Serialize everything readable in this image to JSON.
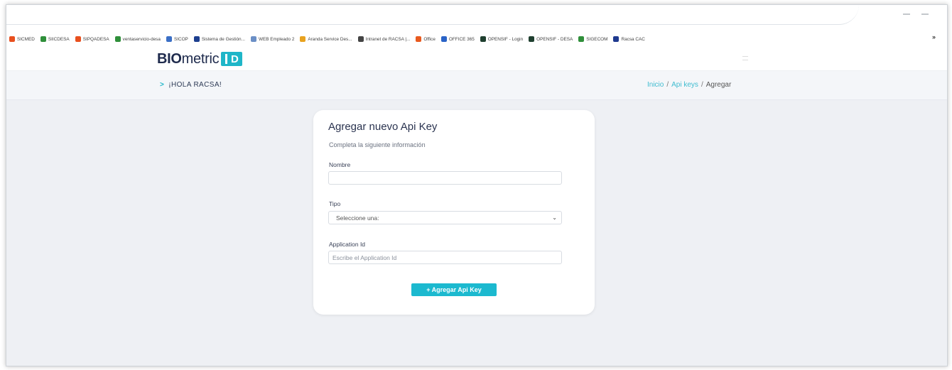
{
  "bookmarks": [
    {
      "label": "SICMED",
      "color": "#e8501f"
    },
    {
      "label": "SIICDESA",
      "color": "#2f8f3a"
    },
    {
      "label": "SIPQADESA",
      "color": "#e8501f"
    },
    {
      "label": "ventaservicio-desa",
      "color": "#2f8f3a"
    },
    {
      "label": "SICOP",
      "color": "#3b6fc6"
    },
    {
      "label": "Sistema de Gestión...",
      "color": "#1d3f8f"
    },
    {
      "label": "WEB Empleado 2",
      "color": "#6b8fc6"
    },
    {
      "label": "Aranda Service Des...",
      "color": "#e8a21f"
    },
    {
      "label": "Intranet de RACSA |...",
      "color": "#444444"
    },
    {
      "label": "Office",
      "color": "#e85a1f"
    },
    {
      "label": "OFFICE 365",
      "color": "#2a63c7"
    },
    {
      "label": "OPENSIF - Login",
      "color": "#1f3f2f"
    },
    {
      "label": "OPENSIF - DESA",
      "color": "#1f3f2f"
    },
    {
      "label": "SIGECOM",
      "color": "#2f8f3a"
    },
    {
      "label": "Racsa CAC",
      "color": "#1f3a8f"
    }
  ],
  "bookmarks_more": "»",
  "brand": {
    "bold": "BIO",
    "thin": "metric",
    "id": "D"
  },
  "header": {
    "greeting": "¡HOLA RACSA!",
    "breadcrumb": {
      "home": "Inicio",
      "section": "Api keys",
      "current": "Agregar",
      "separator": "/"
    }
  },
  "form": {
    "title": "Agregar nuevo Api Key",
    "subtitle": "Completa la siguiente información",
    "nombre_label": "Nombre",
    "nombre_value": "",
    "tipo_label": "Tipo",
    "tipo_selected": "Seleccione una:",
    "appid_label": "Application Id",
    "appid_placeholder": "Escribe el Application Id",
    "submit_label": "+ Agregar Api Key"
  },
  "colors": {
    "accent": "#1cb9cf",
    "brand_dark": "#1f2b4d"
  }
}
